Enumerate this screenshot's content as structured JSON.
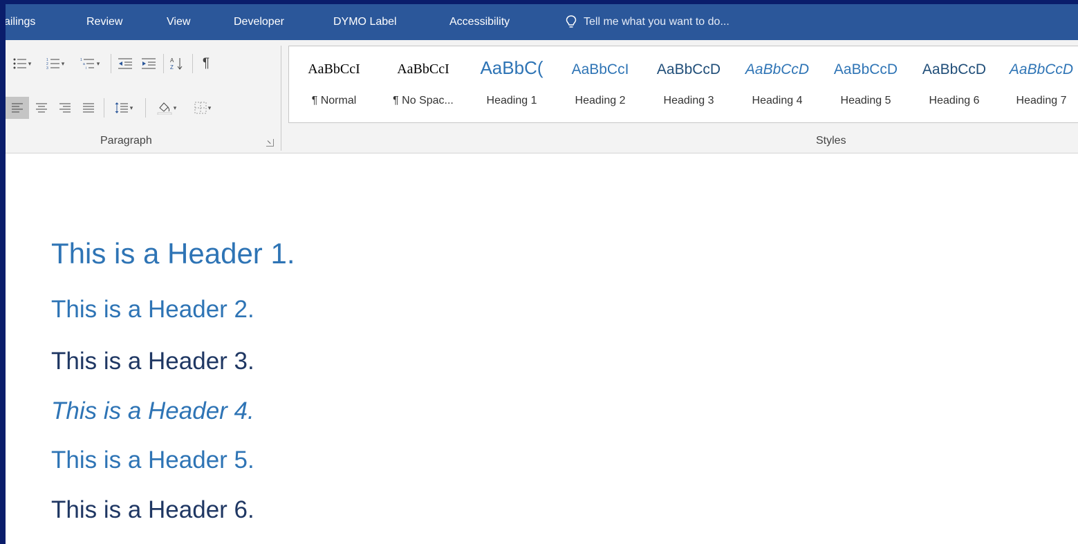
{
  "ribbon": {
    "tabs": [
      {
        "label": "ailings"
      },
      {
        "label": "Review"
      },
      {
        "label": "View"
      },
      {
        "label": "Developer"
      },
      {
        "label": "DYMO Label"
      },
      {
        "label": "Accessibility"
      }
    ],
    "tell_me": {
      "text": "Tell me what you want to do..."
    },
    "paragraph_group": {
      "label": "Paragraph"
    },
    "styles_group": {
      "label": "Styles"
    },
    "styles": [
      {
        "sample": "AaBbCcI",
        "name": "¶ Normal"
      },
      {
        "sample": "AaBbCcI",
        "name": "¶ No Spac..."
      },
      {
        "sample": "AaBbC(",
        "name": "Heading 1"
      },
      {
        "sample": "AaBbCcI",
        "name": "Heading 2"
      },
      {
        "sample": "AaBbCcD",
        "name": "Heading 3"
      },
      {
        "sample": "AaBbCcD",
        "name": "Heading 4"
      },
      {
        "sample": "AaBbCcD",
        "name": "Heading 5"
      },
      {
        "sample": "AaBbCcD",
        "name": "Heading 6"
      },
      {
        "sample": "AaBbCcD",
        "name": "Heading 7"
      }
    ]
  },
  "document": {
    "lines": [
      "This is a Header 1.",
      "This is a Header 2.",
      "This is a Header 3.",
      "This is a Header 4.",
      "This is a Header 5.",
      "This is a Header 6."
    ]
  },
  "colors": {
    "ribbon_tab_bg": "#2b579a",
    "ribbon_body_bg": "#f3f3f3",
    "heading_blue": "#2e74b5",
    "heading_dark": "#1f3763",
    "background_frame": "#0a1d6b"
  },
  "icons": [
    "bullets-icon",
    "numbering-icon",
    "multilevel-list-icon",
    "decrease-indent-icon",
    "increase-indent-icon",
    "sort-icon",
    "show-marks-icon",
    "align-left-icon",
    "align-center-icon",
    "align-right-icon",
    "justify-icon",
    "line-spacing-icon",
    "shading-icon",
    "borders-icon",
    "lightbulb-icon"
  ]
}
